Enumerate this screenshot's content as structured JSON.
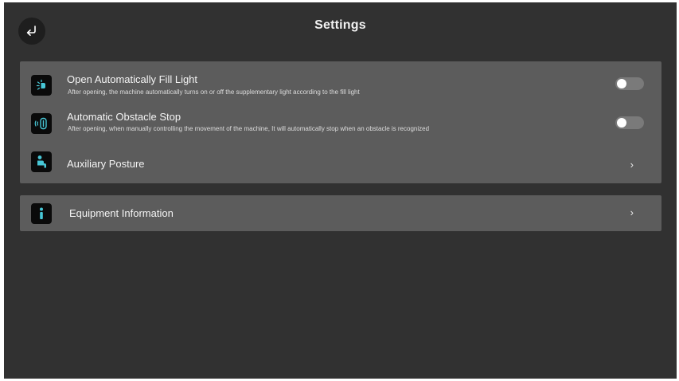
{
  "header": {
    "title": "Settings",
    "back_icon": "return-arrow-icon"
  },
  "settings": {
    "items": [
      {
        "title": "Open Automatically Fill Light",
        "description": "After opening, the machine automatically turns on or off the supplementary light according to the fill light",
        "icon": "fill-light-icon",
        "control": "toggle",
        "toggle_on": false
      },
      {
        "title": "Automatic Obstacle Stop",
        "description": "After opening, when manually controlling the movement of the machine, It will automatically stop when an obstacle is recognized",
        "icon": "obstacle-sensor-icon",
        "control": "toggle",
        "toggle_on": false
      },
      {
        "title": "Auxiliary Posture",
        "icon": "posture-icon",
        "control": "chevron",
        "chevron": "›"
      }
    ]
  },
  "equipment": {
    "title": "Equipment Information",
    "icon": "info-icon",
    "chevron": "›"
  },
  "colors": {
    "background": "#313131",
    "card": "#5c5c5c",
    "icon_accent": "#47c7d6",
    "toggle_off": "#7a7a7a"
  }
}
